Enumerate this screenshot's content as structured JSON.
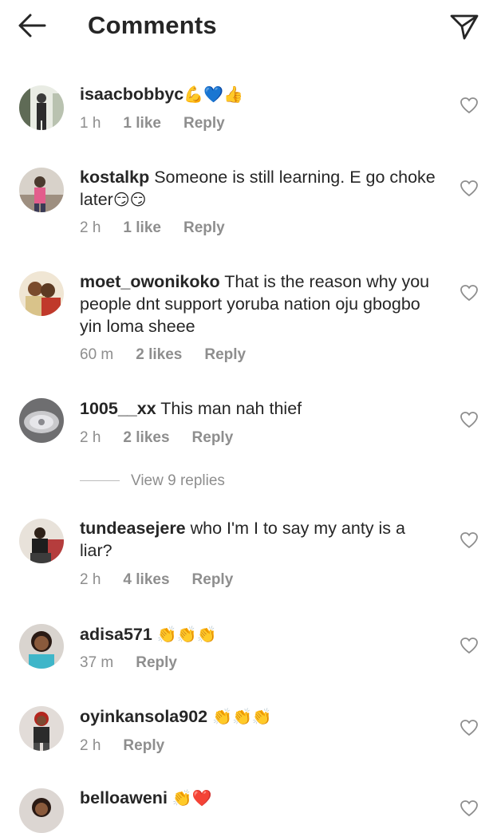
{
  "header": {
    "title": "Comments",
    "back_icon": "arrow-left-icon",
    "send_icon": "paper-plane-icon"
  },
  "comments": [
    {
      "username": "isaacbobbyc",
      "text": "",
      "emoji": "💪💙👍",
      "time": "1 h",
      "likes": "1 like",
      "reply": "Reply"
    },
    {
      "username": "kostalkp",
      "text": " Someone is still learning. E go choke later",
      "emoji": "😏😏",
      "time": "2 h",
      "likes": "1 like",
      "reply": "Reply"
    },
    {
      "username": "moet_owonikoko",
      "text": " That is the reason why you people dnt support yoruba nation oju gbogbo yin loma sheee",
      "emoji": "",
      "time": "60 m",
      "likes": "2 likes",
      "reply": "Reply"
    },
    {
      "username": "1005__xx",
      "text": " This man nah thief",
      "emoji": "",
      "time": "2 h",
      "likes": "2 likes",
      "reply": "Reply"
    },
    {
      "username": "tundeasejere",
      "text": " who I'm I to say my anty is a liar?",
      "emoji": "",
      "time": "2 h",
      "likes": "4 likes",
      "reply": "Reply"
    },
    {
      "username": "adisa571",
      "text": " ",
      "emoji": "👏👏👏",
      "time": "37 m",
      "likes": "",
      "reply": "Reply"
    },
    {
      "username": "oyinkansola902",
      "text": " ",
      "emoji": "👏👏👏",
      "time": "2 h",
      "likes": "",
      "reply": "Reply"
    },
    {
      "username": "belloaweni",
      "text": " ",
      "emoji": "👏❤️",
      "time": "",
      "likes": "",
      "reply": ""
    }
  ],
  "view_replies": "View 9 replies",
  "colors": {
    "text": "#262626",
    "secondary": "#8e8e8e"
  }
}
